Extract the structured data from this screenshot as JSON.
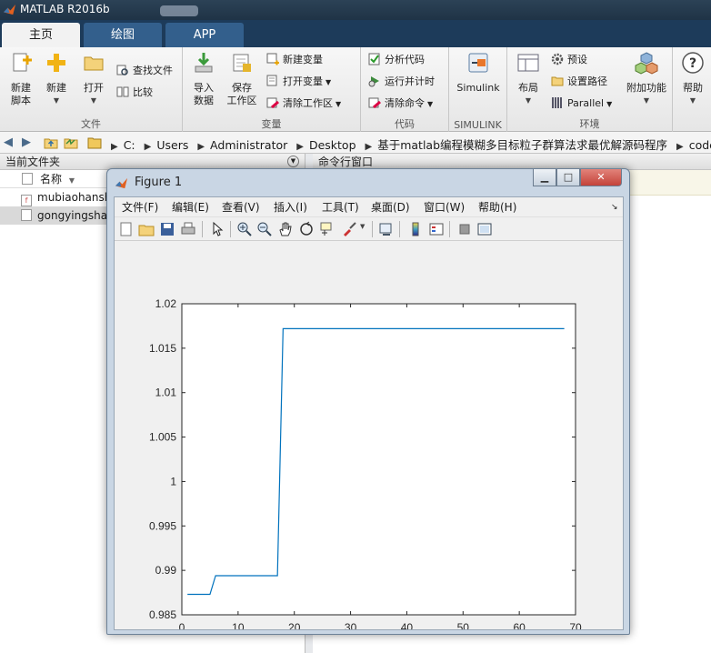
{
  "app": {
    "title": "MATLAB R2016b"
  },
  "tabs": [
    {
      "label": "主页",
      "active": true
    },
    {
      "label": "绘图",
      "active": false
    },
    {
      "label": "APP",
      "active": false
    }
  ],
  "ribbon": {
    "file": {
      "section_label": "文件",
      "new_script": "新建\n脚本",
      "new": "新建",
      "open": "打开",
      "find_files": "查找文件",
      "compare": "比较"
    },
    "variable": {
      "section_label": "变量",
      "import": "导入\n数据",
      "save_ws": "保存\n工作区",
      "new_var": "新建变量",
      "open_var": "打开变量",
      "clear_ws": "清除工作区"
    },
    "code": {
      "section_label": "代码",
      "analyze": "分析代码",
      "run_time": "运行并计时",
      "clear_cmd": "清除命令"
    },
    "simulink": {
      "section_label": "SIMULINK",
      "label": "Simulink"
    },
    "env": {
      "section_label": "环境",
      "layout": "布局",
      "prefs": "预设",
      "set_path": "设置路径",
      "parallel": "Parallel",
      "addons": "附加功能"
    },
    "help": {
      "label": "帮助"
    }
  },
  "address": {
    "crumbs": [
      "C:",
      "Users",
      "Administrator",
      "Desktop",
      "基于matlab编程模糊多目标粒子群算法求最优解源码程序",
      "code"
    ]
  },
  "current_folder": {
    "title": "当前文件夹",
    "column": "名称",
    "files": [
      {
        "name": "mubiaohanshu.m",
        "selected": false
      },
      {
        "name": "gongyingshang.m",
        "selected": true
      }
    ]
  },
  "command_window": {
    "title": "命令行窗口"
  },
  "figure": {
    "title": "Figure 1",
    "menu": [
      "文件(F)",
      "编辑(E)",
      "查看(V)",
      "插入(I)",
      "工具(T)",
      "桌面(D)",
      "窗口(W)",
      "帮助(H)"
    ]
  },
  "chart_data": {
    "type": "line",
    "title": "",
    "xlabel": "",
    "ylabel": "",
    "xlim": [
      0,
      70
    ],
    "ylim": [
      0.985,
      1.02
    ],
    "xticks": [
      "0",
      "10",
      "20",
      "30",
      "40",
      "50",
      "60",
      "70"
    ],
    "yticks": [
      "0.985",
      "0.99",
      "0.995",
      "1",
      "1.005",
      "1.01",
      "1.015",
      "1.02"
    ],
    "grid": false,
    "line_color": "#0072bd",
    "series": [
      {
        "x": [
          1,
          5,
          6,
          17,
          18,
          68
        ],
        "y": [
          0.9873,
          0.9873,
          0.9894,
          0.9894,
          1.0172,
          1.0172
        ]
      }
    ]
  }
}
